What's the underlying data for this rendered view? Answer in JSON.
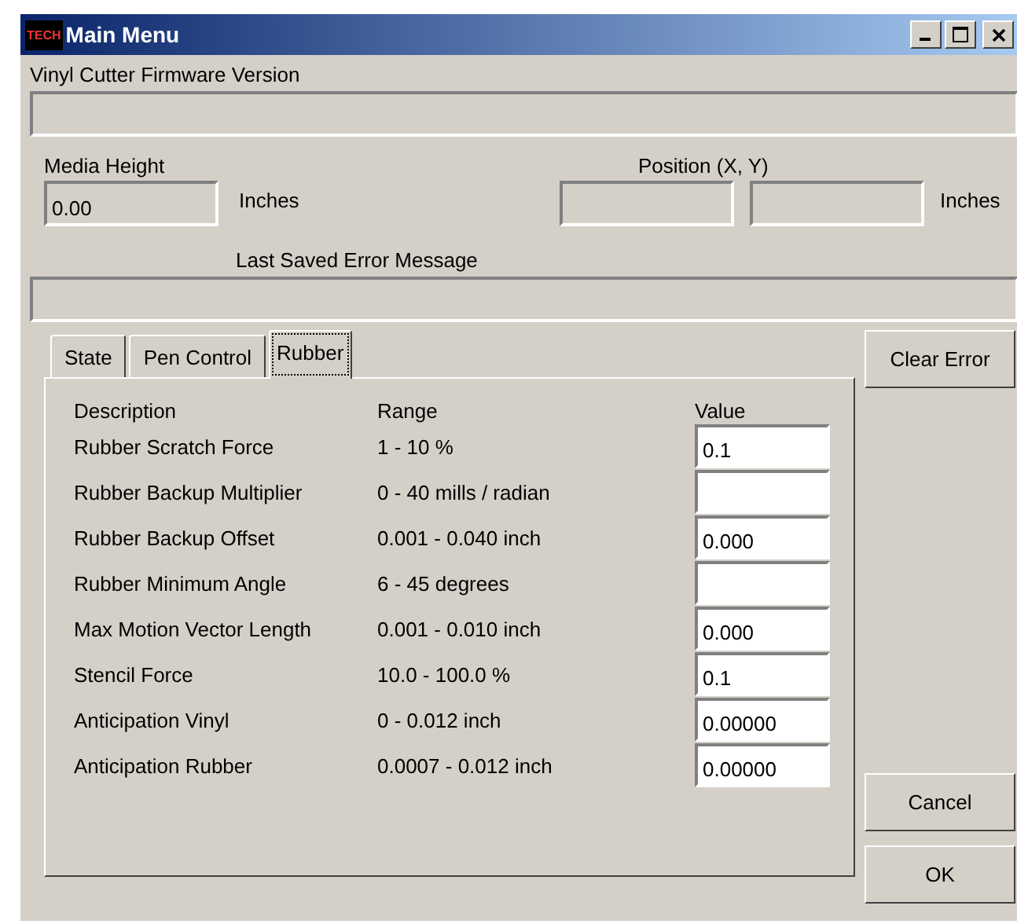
{
  "window": {
    "icon_text": "TECH",
    "title": "Main Menu"
  },
  "firmware": {
    "label": "Vinyl Cutter Firmware Version"
  },
  "media_height": {
    "label": "Media Height",
    "value": "0.00",
    "unit": "Inches"
  },
  "position": {
    "label": "Position (X, Y)",
    "unit": "Inches"
  },
  "error_message": {
    "label": "Last Saved Error Message"
  },
  "tabs": [
    {
      "label": "State",
      "selected": false
    },
    {
      "label": "Pen Control",
      "selected": false
    },
    {
      "label": "Rubber",
      "selected": true
    }
  ],
  "table": {
    "columns": [
      "Description",
      "Range",
      "Value"
    ],
    "rows": [
      {
        "description": "Rubber Scratch Force",
        "range": "1 - 10 %",
        "value": "0.1"
      },
      {
        "description": "Rubber Backup Multiplier",
        "range": "0 - 40 mills / radian"
      },
      {
        "description": "Rubber Backup Offset",
        "range": "0.001 - 0.040 inch",
        "value": "0.000"
      },
      {
        "description": "Rubber Minimum Angle",
        "range": "6 - 45 degrees"
      },
      {
        "description": "Max Motion Vector Length",
        "range": "0.001 - 0.010 inch",
        "value": "0.000"
      },
      {
        "description": "Stencil Force",
        "range": "10.0 - 100.0 %",
        "value": "0.1"
      },
      {
        "description": "Anticipation Vinyl",
        "range": "0 - 0.012 inch",
        "value": "0.00000"
      },
      {
        "description": "Anticipation Rubber",
        "range": "0.0007 - 0.012 inch",
        "value": "0.00000"
      }
    ]
  },
  "buttons": {
    "clear_error": "Clear Error",
    "cancel": "Cancel",
    "ok": "OK"
  }
}
